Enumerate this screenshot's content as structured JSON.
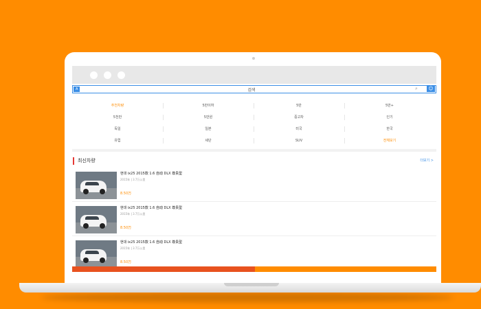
{
  "search": {
    "tag": "A",
    "value": "검색"
  },
  "categories": [
    {
      "label": "추천차량",
      "highlight": true
    },
    {
      "label": "5만이하",
      "highlight": false
    },
    {
      "label": "5만",
      "highlight": false
    },
    {
      "label": "5만+",
      "highlight": false
    },
    {
      "label": "5천만",
      "highlight": false
    },
    {
      "label": "5만원",
      "highlight": false
    },
    {
      "label": "중고차",
      "highlight": false
    },
    {
      "label": "인기",
      "highlight": false
    },
    {
      "label": "독일",
      "highlight": false
    },
    {
      "label": "일본",
      "highlight": false
    },
    {
      "label": "미국",
      "highlight": false
    },
    {
      "label": "한국",
      "highlight": false
    },
    {
      "label": "유럽",
      "highlight": false
    },
    {
      "label": "세단",
      "highlight": false
    },
    {
      "label": "SUV",
      "highlight": false
    },
    {
      "label": "전체보기",
      "highlight": true
    }
  ],
  "section": {
    "title": "최신차량",
    "more": "더보기 >"
  },
  "listings": [
    {
      "title": "현대 ix25 2015款 1.6 自动 DLX 尊贵型",
      "meta": "2015年 | 3.7万公里",
      "price": "8.50万"
    },
    {
      "title": "현대 ix25 2015款 1.6 自动 DLX 尊贵型",
      "meta": "2015年 | 3.7万公里",
      "price": "8.50万"
    },
    {
      "title": "현대 ix25 2015款 1.6 自动 DLX 尊贵型",
      "meta": "2015年 | 3.7万公里",
      "price": "8.50万"
    }
  ],
  "colors": {
    "accent": "#ff8c00",
    "link": "#3a8ee6",
    "marker": "#e53935"
  }
}
